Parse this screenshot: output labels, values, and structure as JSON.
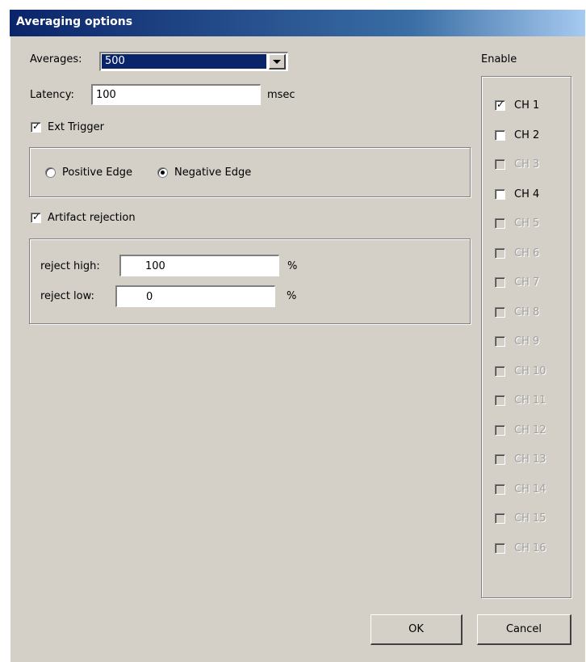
{
  "window": {
    "title": "Averaging options"
  },
  "averages": {
    "label": "Averages:",
    "selected": "500"
  },
  "latency": {
    "label": "Latency:",
    "value": "100",
    "unit": "msec"
  },
  "ext_trigger": {
    "label": "Ext Trigger",
    "checked": true
  },
  "edge": {
    "positive_label": "Positive Edge",
    "negative_label": "Negative Edge",
    "selected": "negative"
  },
  "artifact": {
    "label": "Artifact rejection",
    "checked": true,
    "reject_high_label": "reject high:",
    "reject_high_value": "100",
    "reject_low_label": "reject low:",
    "reject_low_value": "0",
    "unit": "%"
  },
  "enable": {
    "title": "Enable",
    "channels": [
      {
        "label": "CH 1",
        "checked": true,
        "enabled": true
      },
      {
        "label": "CH 2",
        "checked": false,
        "enabled": true
      },
      {
        "label": "CH 3",
        "checked": false,
        "enabled": false
      },
      {
        "label": "CH 4",
        "checked": false,
        "enabled": true
      },
      {
        "label": "CH 5",
        "checked": false,
        "enabled": false
      },
      {
        "label": "CH 6",
        "checked": false,
        "enabled": false
      },
      {
        "label": "CH 7",
        "checked": false,
        "enabled": false
      },
      {
        "label": "CH 8",
        "checked": false,
        "enabled": false
      },
      {
        "label": "CH 9",
        "checked": false,
        "enabled": false
      },
      {
        "label": "CH 10",
        "checked": false,
        "enabled": false
      },
      {
        "label": "CH 11",
        "checked": false,
        "enabled": false
      },
      {
        "label": "CH 12",
        "checked": false,
        "enabled": false
      },
      {
        "label": "CH 13",
        "checked": false,
        "enabled": false
      },
      {
        "label": "CH 14",
        "checked": false,
        "enabled": false
      },
      {
        "label": "CH 15",
        "checked": false,
        "enabled": false
      },
      {
        "label": "CH 16",
        "checked": false,
        "enabled": false
      }
    ]
  },
  "buttons": {
    "ok": "OK",
    "cancel": "Cancel"
  }
}
